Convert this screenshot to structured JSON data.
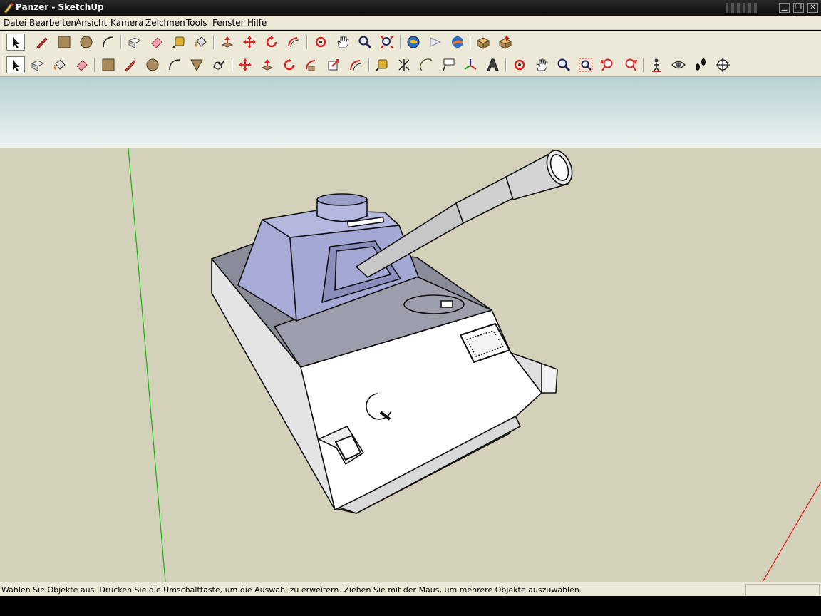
{
  "window": {
    "title": "Panzer - SketchUp",
    "buttons": [
      "minimize",
      "maximize",
      "close"
    ]
  },
  "menubar": {
    "items": [
      {
        "label": "Datei"
      },
      {
        "label": "Bearbeiten"
      },
      {
        "label": "Ansicht"
      },
      {
        "label": "Kamera"
      },
      {
        "label": "Zeichnen"
      },
      {
        "label": "Tools"
      },
      {
        "label": "Fenster"
      },
      {
        "label": "Hilfe"
      }
    ]
  },
  "toolbar1": {
    "tools": [
      {
        "icon": "select-arrow-icon",
        "selected": true
      },
      {
        "icon": "pencil-line-icon"
      },
      {
        "icon": "rectangle-icon"
      },
      {
        "icon": "circle-icon"
      },
      {
        "icon": "arc-icon"
      },
      {
        "icon": "make-component-icon"
      },
      {
        "icon": "eraser-icon"
      },
      {
        "icon": "tape-measure-icon"
      },
      {
        "icon": "paint-bucket-icon"
      },
      {
        "icon": "push-pull-icon"
      },
      {
        "icon": "move-icon"
      },
      {
        "icon": "rotate-icon"
      },
      {
        "icon": "follow-me-icon"
      },
      {
        "icon": "orbit-icon"
      },
      {
        "icon": "pan-hand-icon"
      },
      {
        "icon": "zoom-icon"
      },
      {
        "icon": "zoom-extents-icon"
      },
      {
        "icon": "3d-warehouse-icon"
      },
      {
        "icon": "share-model-icon"
      },
      {
        "icon": "google-earth-icon"
      },
      {
        "icon": "get-models-icon"
      },
      {
        "icon": "share-component-icon"
      }
    ]
  },
  "toolbar2": {
    "tools": [
      {
        "icon": "select-arrow-icon",
        "selected": true
      },
      {
        "icon": "make-component-icon"
      },
      {
        "icon": "paint-bucket-icon"
      },
      {
        "icon": "eraser-icon"
      },
      {
        "icon": "rectangle-icon"
      },
      {
        "icon": "pencil-line-icon"
      },
      {
        "icon": "circle-icon"
      },
      {
        "icon": "arc-icon"
      },
      {
        "icon": "polygon-icon"
      },
      {
        "icon": "freehand-icon"
      },
      {
        "icon": "move-icon"
      },
      {
        "icon": "push-pull-icon"
      },
      {
        "icon": "rotate-icon"
      },
      {
        "icon": "follow-me-icon"
      },
      {
        "icon": "scale-icon"
      },
      {
        "icon": "offset-icon"
      },
      {
        "icon": "tape-measure-icon"
      },
      {
        "icon": "dimension-icon"
      },
      {
        "icon": "protractor-icon"
      },
      {
        "icon": "text-label-icon"
      },
      {
        "icon": "axes-icon"
      },
      {
        "icon": "3d-text-icon"
      },
      {
        "icon": "orbit-icon"
      },
      {
        "icon": "pan-hand-icon"
      },
      {
        "icon": "zoom-icon"
      },
      {
        "icon": "zoom-window-icon"
      },
      {
        "icon": "previous-view-icon"
      },
      {
        "icon": "next-view-icon"
      },
      {
        "icon": "position-camera-icon"
      },
      {
        "icon": "look-around-icon"
      },
      {
        "icon": "walk-icon"
      },
      {
        "icon": "section-plane-icon"
      }
    ]
  },
  "status": {
    "message": "Wählen Sie Objekte aus. Drücken Sie die Umschalttaste, um die Auswahl zu erweitern. Ziehen Sie mit der Maus, um mehrere Objekte auszuwählen.",
    "measurements": ""
  },
  "colors": {
    "sky_top": "#b7d1d4",
    "sky_bottom": "#eef3f2",
    "ground": "#d4d1ba",
    "axis_green": "#12b412",
    "axis_red": "#e21a1a",
    "turret": "#a7abd6",
    "hull_top": "#8a8b98",
    "hull_side": "#ffffff",
    "barrel": "#c9c9c9"
  }
}
